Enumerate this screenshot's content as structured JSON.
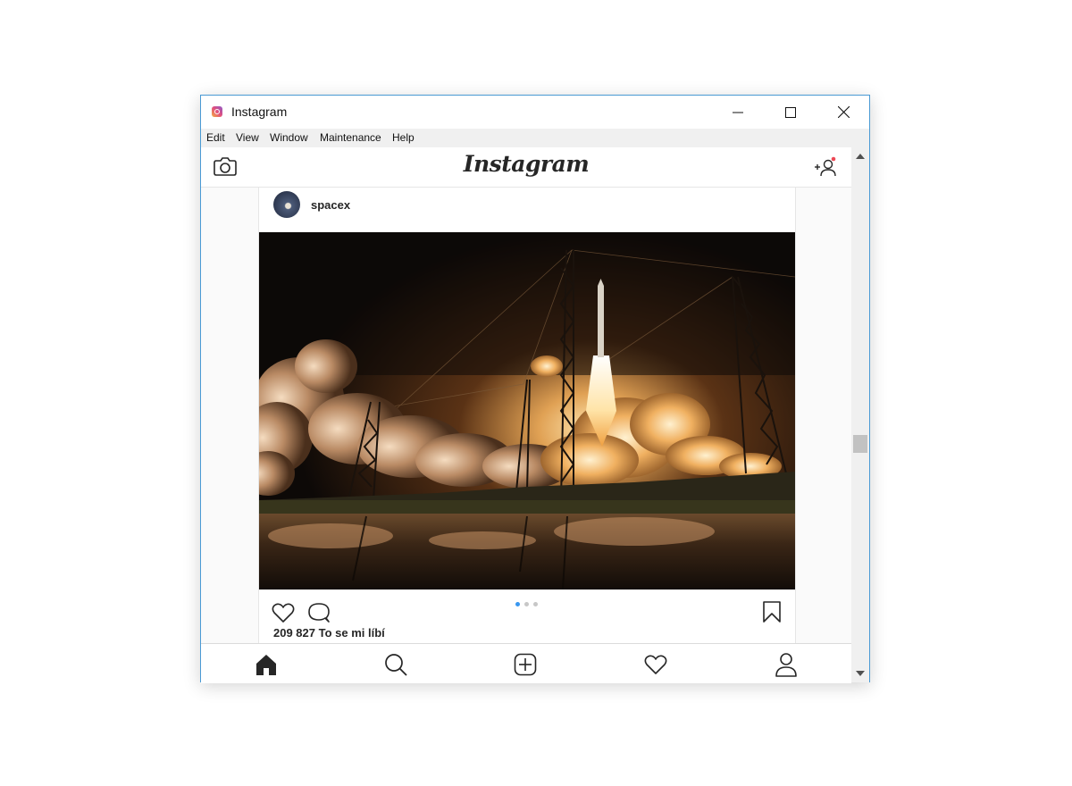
{
  "window": {
    "title": "Instagram",
    "controls": [
      "minimize",
      "maximize",
      "close"
    ]
  },
  "menu": {
    "items": [
      "Edit",
      "View",
      "Window",
      "Maintenance",
      "Help"
    ]
  },
  "header": {
    "logo_text": "Instagram",
    "left_icon": "camera-icon",
    "right_icon": "add-person-icon",
    "notification_color": "#ed4956"
  },
  "post": {
    "username": "spacex",
    "image_description": "rocket launch at night",
    "carousel_dots": 3,
    "carousel_active": 0,
    "carousel_active_color": "#3897f0",
    "likes_text": "209 827 To se mi líbí",
    "actions": [
      "heart-icon",
      "comment-icon",
      "bookmark-icon"
    ]
  },
  "bottom_nav": {
    "items": [
      "home-icon",
      "search-icon",
      "add-post-icon",
      "activity-heart-icon",
      "profile-icon"
    ],
    "active": "home-icon"
  }
}
